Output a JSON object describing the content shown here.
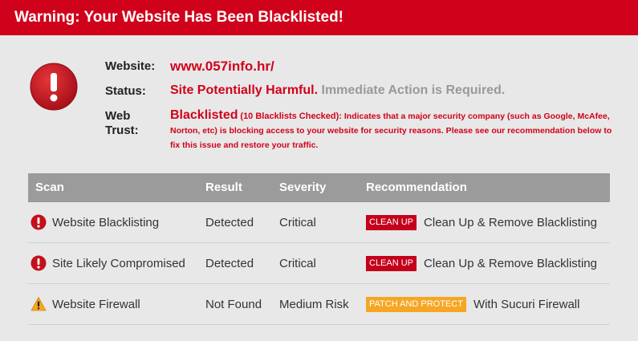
{
  "banner": {
    "title": "Warning: Your Website Has Been Blacklisted!"
  },
  "info": {
    "website_label": "Website:",
    "website_value": "www.057info.hr/",
    "status_label": "Status:",
    "status_value": "Site Potentially Harmful.",
    "status_action": "Immediate Action is Required.",
    "trust_label": "Web Trust:",
    "trust_value": "Blacklisted",
    "trust_checked": "(10 Blacklists Checked):",
    "trust_desc": "Indicates that a major security company (such as Google, McAfee, Norton, etc) is blocking access to your website for security reasons. Please see our recommendation below to fix this issue and restore your traffic."
  },
  "table": {
    "headers": {
      "scan": "Scan",
      "result": "Result",
      "severity": "Severity",
      "recommendation": "Recommendation"
    },
    "rows": [
      {
        "icon": "error-icon",
        "scan": "Website Blacklisting",
        "result": "Detected",
        "severity": "Critical",
        "badge": "CLEAN UP",
        "badge_color": "#c4001b",
        "recommendation": "Clean Up & Remove Blacklisting"
      },
      {
        "icon": "error-icon",
        "scan": "Site Likely Compromised",
        "result": "Detected",
        "severity": "Critical",
        "badge": "CLEAN UP",
        "badge_color": "#c4001b",
        "recommendation": "Clean Up & Remove Blacklisting"
      },
      {
        "icon": "warning-icon",
        "scan": "Website Firewall",
        "result": "Not Found",
        "severity": "Medium Risk",
        "badge": "PATCH AND PROTECT",
        "badge_color": "#f5a623",
        "recommendation": "With Sucuri Firewall"
      }
    ]
  },
  "colors": {
    "brand_red": "#d0021b",
    "header_grey": "#9b9b9b",
    "warning_orange": "#f5a623"
  }
}
